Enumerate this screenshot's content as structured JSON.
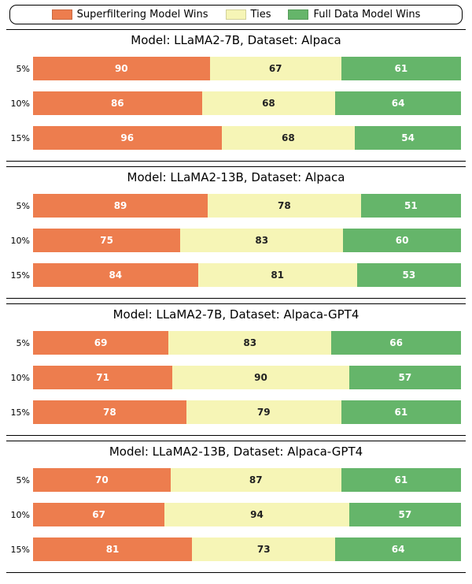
{
  "legend": {
    "win": "Superfiltering Model Wins",
    "ties": "Ties",
    "full": "Full Data Model Wins"
  },
  "colors": {
    "win": "#ed7d4e",
    "ties": "#f6f5b6",
    "full": "#65b56a"
  },
  "panels": [
    {
      "title": "Model: LLaMA2-7B, Dataset: Alpaca",
      "rows": [
        {
          "label": "5%",
          "win": 90,
          "ties": 67,
          "full": 61
        },
        {
          "label": "10%",
          "win": 86,
          "ties": 68,
          "full": 64
        },
        {
          "label": "15%",
          "win": 96,
          "ties": 68,
          "full": 54
        }
      ]
    },
    {
      "title": "Model: LLaMA2-13B, Dataset: Alpaca",
      "rows": [
        {
          "label": "5%",
          "win": 89,
          "ties": 78,
          "full": 51
        },
        {
          "label": "10%",
          "win": 75,
          "ties": 83,
          "full": 60
        },
        {
          "label": "15%",
          "win": 84,
          "ties": 81,
          "full": 53
        }
      ]
    },
    {
      "title": "Model: LLaMA2-7B, Dataset: Alpaca-GPT4",
      "rows": [
        {
          "label": "5%",
          "win": 69,
          "ties": 83,
          "full": 66
        },
        {
          "label": "10%",
          "win": 71,
          "ties": 90,
          "full": 57
        },
        {
          "label": "15%",
          "win": 78,
          "ties": 79,
          "full": 61
        }
      ]
    },
    {
      "title": "Model: LLaMA2-13B, Dataset: Alpaca-GPT4",
      "rows": [
        {
          "label": "5%",
          "win": 70,
          "ties": 87,
          "full": 61
        },
        {
          "label": "10%",
          "win": 67,
          "ties": 94,
          "full": 57
        },
        {
          "label": "15%",
          "win": 81,
          "ties": 73,
          "full": 64
        }
      ]
    }
  ],
  "chart_data": {
    "type": "bar",
    "orientation": "horizontal-stacked",
    "series_labels": [
      "Superfiltering Model Wins",
      "Ties",
      "Full Data Model Wins"
    ],
    "panels": [
      {
        "title": "Model: LLaMA2-7B, Dataset: Alpaca",
        "categories": [
          "5%",
          "10%",
          "15%"
        ],
        "series": [
          {
            "name": "Superfiltering Model Wins",
            "values": [
              90,
              86,
              96
            ]
          },
          {
            "name": "Ties",
            "values": [
              67,
              68,
              68
            ]
          },
          {
            "name": "Full Data Model Wins",
            "values": [
              61,
              64,
              54
            ]
          }
        ]
      },
      {
        "title": "Model: LLaMA2-13B, Dataset: Alpaca",
        "categories": [
          "5%",
          "10%",
          "15%"
        ],
        "series": [
          {
            "name": "Superfiltering Model Wins",
            "values": [
              89,
              75,
              84
            ]
          },
          {
            "name": "Ties",
            "values": [
              78,
              83,
              81
            ]
          },
          {
            "name": "Full Data Model Wins",
            "values": [
              51,
              60,
              53
            ]
          }
        ]
      },
      {
        "title": "Model: LLaMA2-7B, Dataset: Alpaca-GPT4",
        "categories": [
          "5%",
          "10%",
          "15%"
        ],
        "series": [
          {
            "name": "Superfiltering Model Wins",
            "values": [
              69,
              71,
              78
            ]
          },
          {
            "name": "Ties",
            "values": [
              83,
              90,
              79
            ]
          },
          {
            "name": "Full Data Model Wins",
            "values": [
              66,
              57,
              61
            ]
          }
        ]
      },
      {
        "title": "Model: LLaMA2-13B, Dataset: Alpaca-GPT4",
        "categories": [
          "5%",
          "10%",
          "15%"
        ],
        "series": [
          {
            "name": "Superfiltering Model Wins",
            "values": [
              70,
              67,
              81
            ]
          },
          {
            "name": "Ties",
            "values": [
              87,
              94,
              73
            ]
          },
          {
            "name": "Full Data Model Wins",
            "values": [
              61,
              57,
              64
            ]
          }
        ]
      }
    ]
  }
}
